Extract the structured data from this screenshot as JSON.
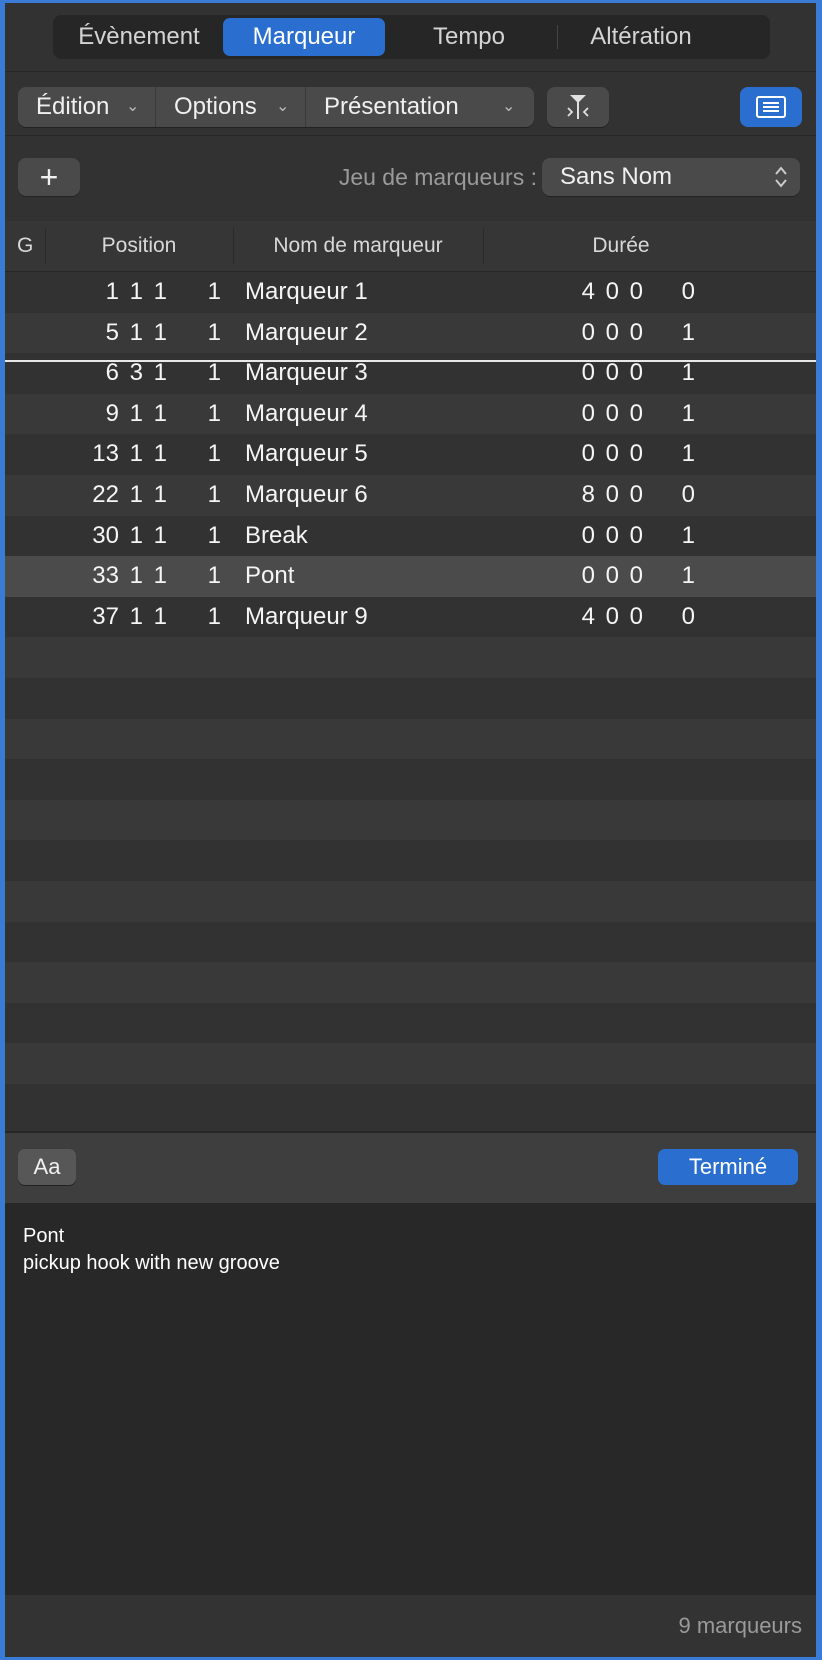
{
  "tabs": [
    "Évènement",
    "Marqueur",
    "Tempo",
    "Altération"
  ],
  "active_tab": "Marqueur",
  "toolbar": {
    "edit_label": "Édition",
    "options_label": "Options",
    "view_label": "Présentation"
  },
  "marker_set": {
    "label": "Jeu de marqueurs :",
    "value": "Sans Nom"
  },
  "table": {
    "headers": {
      "g": "G",
      "position": "Position",
      "name": "Nom de marqueur",
      "length": "Durée"
    },
    "rows": [
      {
        "pos": [
          "1",
          "1",
          "1",
          "1"
        ],
        "name": "Marqueur 1",
        "len": [
          "4",
          "0",
          "0",
          "0"
        ],
        "selected": false
      },
      {
        "pos": [
          "5",
          "1",
          "1",
          "1"
        ],
        "name": "Marqueur 2",
        "len": [
          "0",
          "0",
          "0",
          "1"
        ],
        "selected": false
      },
      {
        "pos": [
          "6",
          "3",
          "1",
          "1"
        ],
        "name": "Marqueur 3",
        "len": [
          "0",
          "0",
          "0",
          "1"
        ],
        "selected": false
      },
      {
        "pos": [
          "9",
          "1",
          "1",
          "1"
        ],
        "name": "Marqueur 4",
        "len": [
          "0",
          "0",
          "0",
          "1"
        ],
        "selected": false
      },
      {
        "pos": [
          "13",
          "1",
          "1",
          "1"
        ],
        "name": "Marqueur 5",
        "len": [
          "0",
          "0",
          "0",
          "1"
        ],
        "selected": false
      },
      {
        "pos": [
          "22",
          "1",
          "1",
          "1"
        ],
        "name": "Marqueur 6",
        "len": [
          "8",
          "0",
          "0",
          "0"
        ],
        "selected": false
      },
      {
        "pos": [
          "30",
          "1",
          "1",
          "1"
        ],
        "name": "Break",
        "len": [
          "0",
          "0",
          "0",
          "1"
        ],
        "selected": false
      },
      {
        "pos": [
          "33",
          "1",
          "1",
          "1"
        ],
        "name": "Pont",
        "len": [
          "0",
          "0",
          "0",
          "1"
        ],
        "selected": true
      },
      {
        "pos": [
          "37",
          "1",
          "1",
          "1"
        ],
        "name": "Marqueur 9",
        "len": [
          "4",
          "0",
          "0",
          "0"
        ],
        "selected": false
      }
    ]
  },
  "bottom": {
    "font_label": "Aa",
    "done_label": "Terminé"
  },
  "notes": {
    "title": "Pont",
    "body": "pickup hook with new groove"
  },
  "footer": {
    "count": "9 marqueurs"
  },
  "colors": {
    "accent": "#2a6fcf",
    "background": "#323232"
  }
}
